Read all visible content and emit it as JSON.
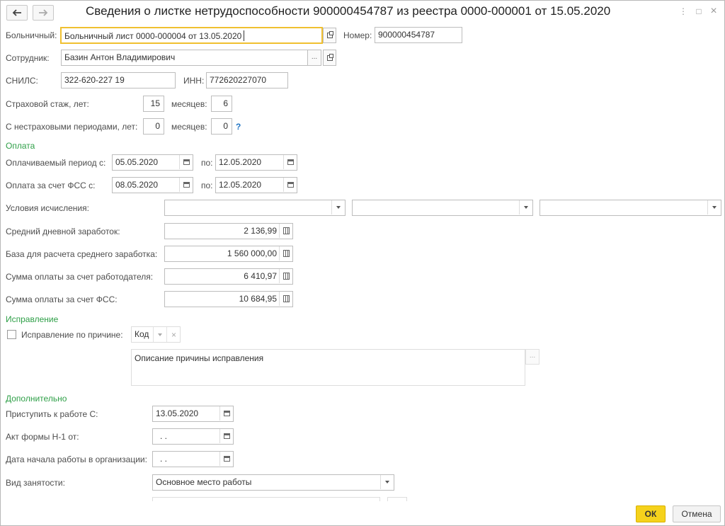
{
  "window": {
    "title": "Сведения о листке нетрудоспособности 900000454787 из реестра 0000-000001 от 15.05.2020",
    "more_label": "⋮",
    "maximize_label": "□",
    "close_label": "×"
  },
  "header": {
    "sick_leave_label": "Больничный:",
    "sick_leave_value": "Больничный лист 0000-000004 от 13.05.2020",
    "number_label": "Номер:",
    "number_value": "900000454787",
    "employee_label": "Сотрудник:",
    "employee_value": "Базин Антон Владимирович",
    "snils_label": "СНИЛС:",
    "snils_value": "322-620-227 19",
    "inn_label": "ИНН:",
    "inn_value": "772620227070",
    "insurance_years_label": "Страховой стаж, лет:",
    "insurance_years_value": "15",
    "insurance_months_label": "месяцев:",
    "insurance_months_value": "6",
    "noninsurance_years_label": "С нестраховыми периодами, лет:",
    "noninsurance_years_value": "0",
    "noninsurance_months_label": "месяцев:",
    "noninsurance_months_value": "0",
    "help_label": "?"
  },
  "payment": {
    "section_title": "Оплата",
    "paid_period_label": "Оплачиваемый период с:",
    "paid_period_from": "05.05.2020",
    "paid_period_to_label": "по:",
    "paid_period_to": "12.05.2020",
    "fss_period_label": "Оплата за счет ФСС с:",
    "fss_period_from": "08.05.2020",
    "fss_period_to_label": "по:",
    "fss_period_to": "12.05.2020",
    "conditions_label": "Условия исчисления:",
    "avg_daily_label": "Средний дневной заработок:",
    "avg_daily_value": "2 136,99",
    "base_label": "База для расчета среднего заработка:",
    "base_value": "1 560 000,00",
    "employer_sum_label": "Сумма оплаты за счет работодателя:",
    "employer_sum_value": "6 410,97",
    "fss_sum_label": "Сумма оплаты за счет ФСС:",
    "fss_sum_value": "10 684,95"
  },
  "correction": {
    "section_title": "Исправление",
    "checkbox_label": "Исправление по причине:",
    "code_placeholder": "Код",
    "clear_label": "×",
    "description_placeholder": "Описание причины исправления",
    "ellipsis_label": "..."
  },
  "additional": {
    "section_title": "Дополнительно",
    "start_work_label": "Приступить к работе С:",
    "start_work_value": "13.05.2020",
    "act_label": "Акт формы Н-1 от:",
    "act_value": " .  .",
    "org_start_label": "Дата начала работы в организации:",
    "org_start_value": " .  .",
    "employment_label": "Вид занятости:",
    "employment_value": "Основное место работы"
  },
  "footer": {
    "ok_label": "ОК",
    "cancel_label": "Отмена"
  },
  "colors": {
    "section_green": "#2e9f47",
    "ok_yellow": "#f5d21c",
    "focus_border": "#f0c030",
    "help_blue": "#1f74c4"
  },
  "icons": [
    "back-arrow-icon",
    "forward-arrow-icon",
    "more-icon",
    "maximize-icon",
    "close-icon",
    "open-icon",
    "ellipsis-icon",
    "calendar-icon",
    "calculator-icon",
    "dropdown-icon"
  ]
}
